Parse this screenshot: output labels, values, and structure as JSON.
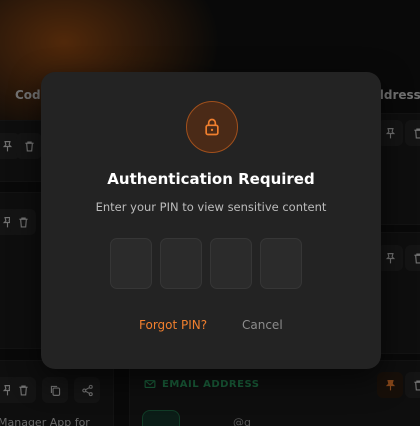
{
  "background": {
    "columns": {
      "code_label": "Code",
      "address_label": "Address"
    },
    "card_text": "Manager App for",
    "email_section_label": "EMAIL ADDRESS",
    "email_snippet": "@g"
  },
  "dialog": {
    "title": "Authentication Required",
    "subtitle": "Enter your PIN to view sensitive content",
    "pin_length": 4,
    "forgot_label": "Forgot PIN?",
    "cancel_label": "Cancel"
  },
  "colors": {
    "accent": "#f07f2e",
    "email_green": "#2fae6a"
  }
}
